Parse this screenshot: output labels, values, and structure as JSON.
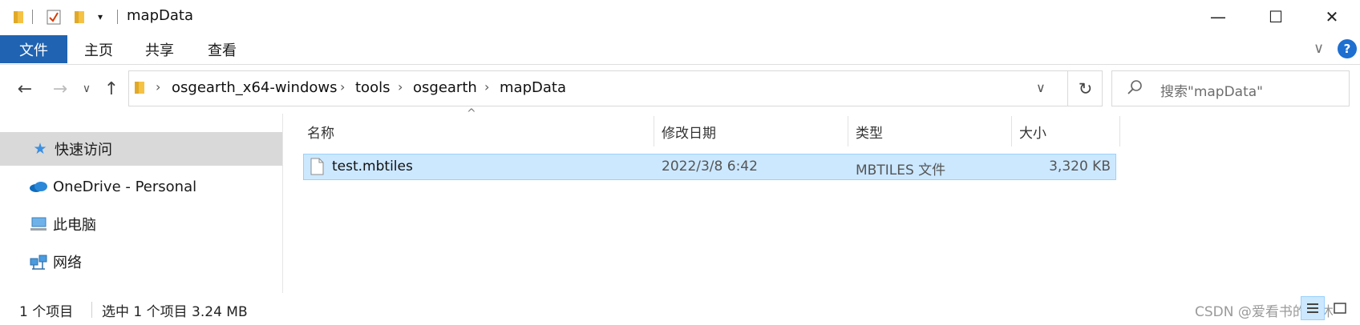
{
  "window": {
    "title": "mapData",
    "minimize_glyph": "—",
    "maximize_glyph": "☐",
    "close_glyph": "✕"
  },
  "quick_access": {
    "icons": [
      "folder-icon",
      "properties-checkbox-icon",
      "new-folder-icon",
      "customize-dropdown-icon"
    ]
  },
  "ribbon": {
    "tabs": [
      {
        "label": "文件",
        "active": true
      },
      {
        "label": "主页"
      },
      {
        "label": "共享"
      },
      {
        "label": "查看"
      }
    ],
    "expand_glyph": "∨",
    "help_glyph": "?"
  },
  "nav": {
    "back_glyph": "←",
    "forward_glyph": "→",
    "recent_glyph": "∨",
    "up_glyph": "↑"
  },
  "address": {
    "crumbs": [
      "osgearth_x64-windows",
      "tools",
      "osgearth",
      "mapData"
    ],
    "dropdown_glyph": "∨",
    "refresh_glyph": "↻"
  },
  "search": {
    "placeholder": "搜索\"mapData\""
  },
  "sidebar": {
    "items": [
      {
        "label": "快速访问",
        "icon": "star-icon",
        "selected": true
      },
      {
        "label": "OneDrive - Personal",
        "icon": "cloud-icon"
      },
      {
        "label": "此电脑",
        "icon": "computer-icon"
      },
      {
        "label": "网络",
        "icon": "network-icon"
      }
    ]
  },
  "columns": {
    "name": "名称",
    "date": "修改日期",
    "type": "类型",
    "size": "大小",
    "sort_glyph": "^"
  },
  "files": [
    {
      "name": "test.mbtiles",
      "date": "2022/3/8 6:42",
      "type": "MBTILES 文件",
      "size": "3,320 KB",
      "selected": true
    }
  ],
  "status": {
    "count": "1 个项目",
    "selection": "选中 1 个项目  3.24 MB"
  },
  "watermark": "CSDN @爱看书的小沐",
  "colors": {
    "accent": "#1f63b2",
    "selection_bg": "#cce8ff",
    "selection_border": "#99d1ff"
  }
}
